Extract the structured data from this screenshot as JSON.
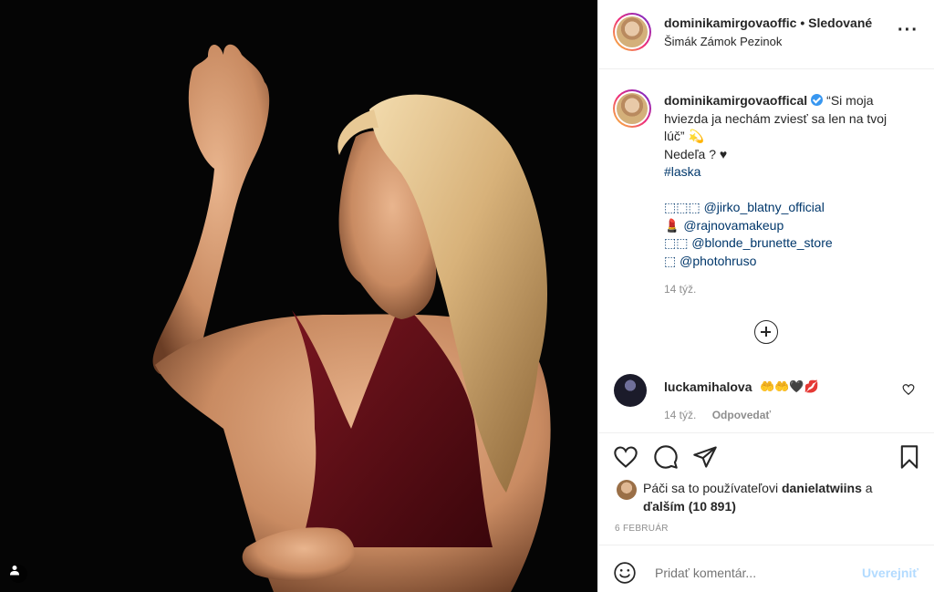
{
  "header": {
    "username": "dominikamirgovaoffic",
    "separator": "•",
    "follow_status": "Sledované",
    "location": "Šimák Zámok Pezinok",
    "more_icon": "more-horizontal-icon"
  },
  "caption": {
    "username": "dominikamirgovaoffical",
    "lines": [
      "“Si moja",
      "hviezda ja nechám zviesť sa len na tvoj",
      "lúč” 💫",
      "Nedeľa ? ♥",
      "#laska",
      "",
      "⬚⬚⬚ @jirko_blatny_official",
      "💄 @rajnovamakeup",
      "⬚⬚ @blonde_brunette_store",
      "⬚ @photohruso"
    ],
    "time": "14 týž."
  },
  "comment": {
    "username": "luckamihalova",
    "text": "🤲🤲🖤💋",
    "time": "14 týž.",
    "reply": "Odpovedať"
  },
  "actions": {
    "likes_prefix": "Páči sa to používateľovi",
    "likes_user": "danielatwiins",
    "likes_and": "a",
    "likes_more": "ďalším (10 891)",
    "date": "6 FEBRUÁR"
  },
  "add_comment": {
    "placeholder": "Pridať komentár...",
    "post_label": "Uverejniť"
  },
  "colors": {
    "link": "#00376b",
    "muted": "#8e8e8e",
    "post_disabled": "#b3dbff",
    "verified": "#3897f0"
  }
}
